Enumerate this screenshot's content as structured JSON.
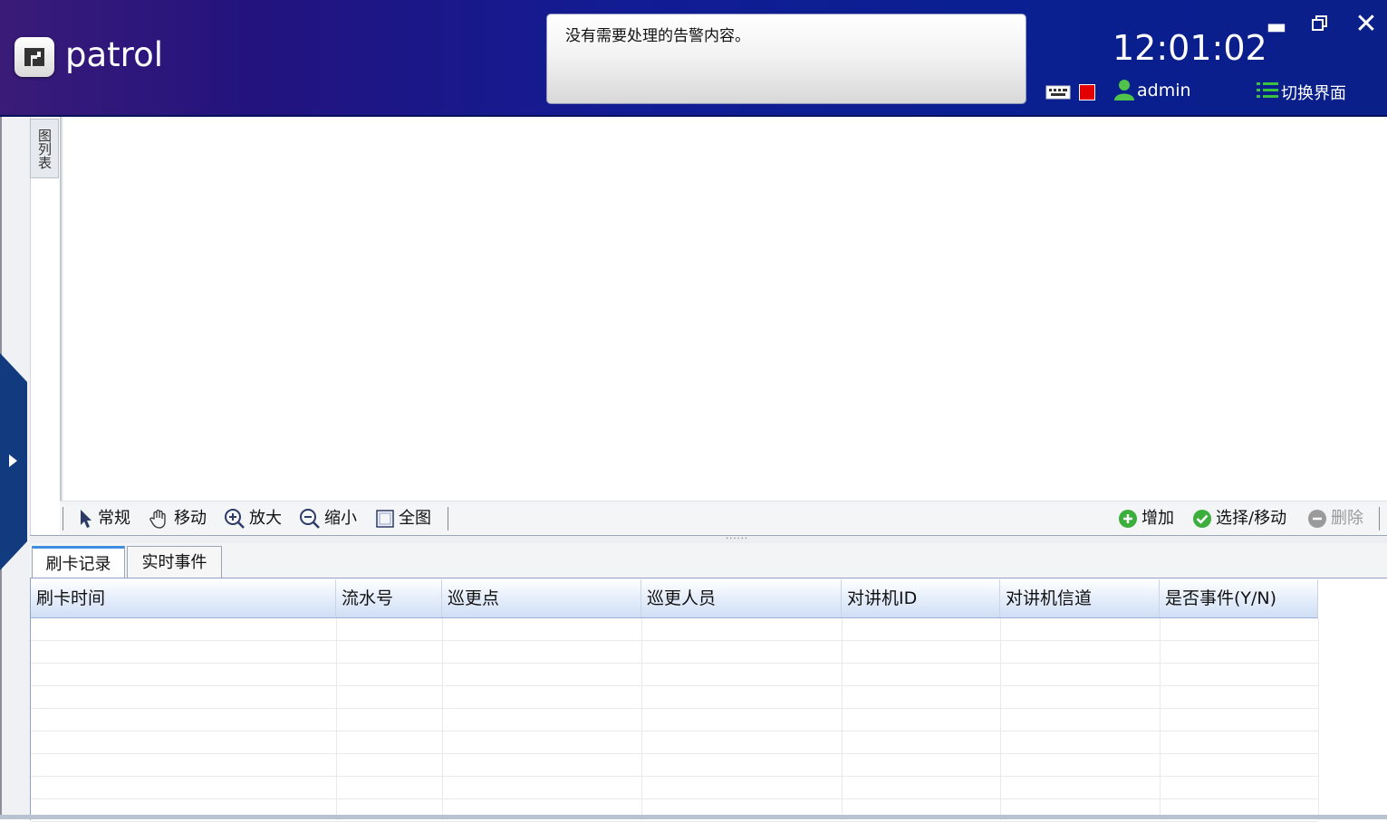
{
  "header": {
    "app_title": "patrol",
    "alert_message": "没有需要处理的告警内容。",
    "clock": "12:01:02",
    "user": "admin",
    "switch_view_label": "切换界面",
    "window_controls": {
      "minimize": "▬",
      "restore": "🗗",
      "close": "✕"
    }
  },
  "side_panel": {
    "layer_tab_label": "图列表"
  },
  "toolbar": {
    "left_tools": [
      {
        "label": "常规",
        "icon": "pointer-icon"
      },
      {
        "label": "移动",
        "icon": "hand-icon"
      },
      {
        "label": "放大",
        "icon": "zoom-in-icon"
      },
      {
        "label": "缩小",
        "icon": "zoom-out-icon"
      },
      {
        "label": "全图",
        "icon": "full-extent-icon"
      }
    ],
    "right_tools": [
      {
        "label": "增加",
        "icon": "add-icon"
      },
      {
        "label": "选择/移动",
        "icon": "check-icon"
      },
      {
        "label": "删除",
        "icon": "remove-icon",
        "disabled": true
      }
    ]
  },
  "bottom_panel": {
    "tabs": [
      {
        "label": "刷卡记录",
        "active": true
      },
      {
        "label": "实时事件",
        "active": false
      }
    ],
    "table": {
      "columns": [
        "刷卡时间",
        "流水号",
        "巡更点",
        "巡更人员",
        "对讲机ID",
        "对讲机信道",
        "是否事件(Y/N)"
      ],
      "rows": []
    }
  },
  "colors": {
    "header_gradient_start": "#3a1b78",
    "header_gradient_end": "#0a1f88",
    "status_indicator": "#e30000",
    "active_tab_accent": "#3d8ee0",
    "add_icon": "#3cae3c"
  }
}
